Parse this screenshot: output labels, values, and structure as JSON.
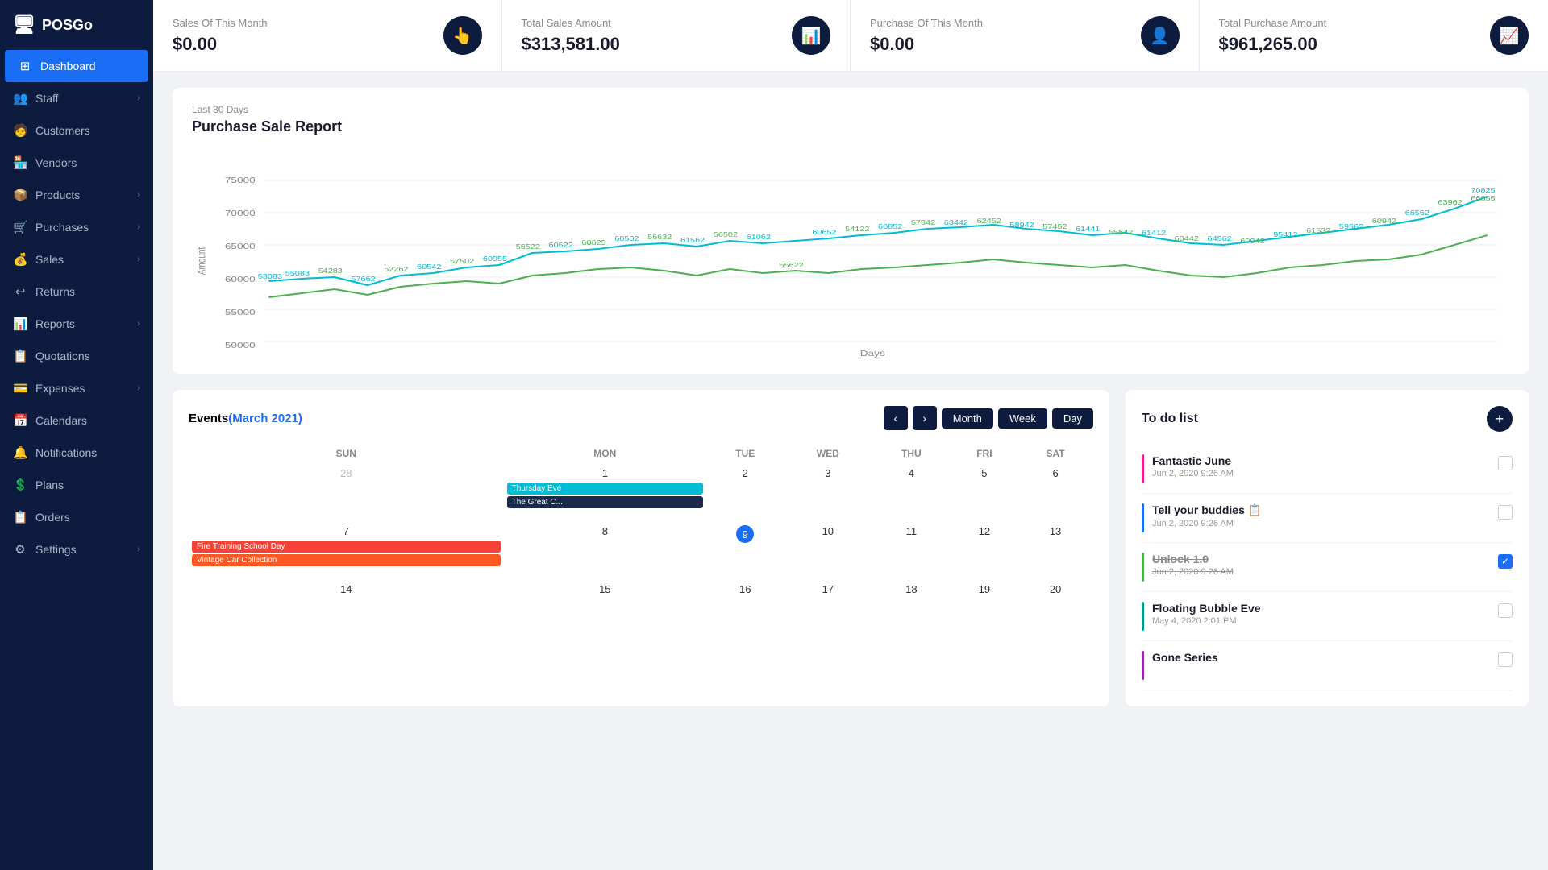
{
  "app": {
    "name": "POSGo",
    "logo_icon": "🖥"
  },
  "sidebar": {
    "items": [
      {
        "id": "dashboard",
        "label": "Dashboard",
        "icon": "⊞",
        "active": true,
        "has_arrow": false
      },
      {
        "id": "staff",
        "label": "Staff",
        "icon": "👥",
        "active": false,
        "has_arrow": true
      },
      {
        "id": "customers",
        "label": "Customers",
        "icon": "🧑",
        "active": false,
        "has_arrow": false
      },
      {
        "id": "vendors",
        "label": "Vendors",
        "icon": "🏪",
        "active": false,
        "has_arrow": false
      },
      {
        "id": "products",
        "label": "Products",
        "icon": "📦",
        "active": false,
        "has_arrow": true
      },
      {
        "id": "purchases",
        "label": "Purchases",
        "icon": "🛒",
        "active": false,
        "has_arrow": true
      },
      {
        "id": "sales",
        "label": "Sales",
        "icon": "💰",
        "active": false,
        "has_arrow": true
      },
      {
        "id": "returns",
        "label": "Returns",
        "icon": "↩",
        "active": false,
        "has_arrow": false
      },
      {
        "id": "reports",
        "label": "Reports",
        "icon": "📊",
        "active": false,
        "has_arrow": true
      },
      {
        "id": "quotations",
        "label": "Quotations",
        "icon": "📋",
        "active": false,
        "has_arrow": false
      },
      {
        "id": "expenses",
        "label": "Expenses",
        "icon": "💳",
        "active": false,
        "has_arrow": true
      },
      {
        "id": "calendars",
        "label": "Calendars",
        "icon": "📅",
        "active": false,
        "has_arrow": false
      },
      {
        "id": "notifications",
        "label": "Notifications",
        "icon": "🔔",
        "active": false,
        "has_arrow": false
      },
      {
        "id": "plans",
        "label": "Plans",
        "icon": "💲",
        "active": false,
        "has_arrow": false
      },
      {
        "id": "orders",
        "label": "Orders",
        "icon": "📋",
        "active": false,
        "has_arrow": false
      },
      {
        "id": "settings",
        "label": "Settings",
        "icon": "⚙",
        "active": false,
        "has_arrow": true
      }
    ]
  },
  "top_cards": [
    {
      "label": "Sales Of This Month",
      "value": "$0.00",
      "icon": "👆"
    },
    {
      "label": "Total Sales Amount",
      "value": "$313,581.00",
      "icon": "📊"
    },
    {
      "label": "Purchase Of This Month",
      "value": "$0.00",
      "icon": "👤"
    },
    {
      "label": "Total Purchase Amount",
      "value": "$961,265.00",
      "icon": "📈"
    }
  ],
  "chart": {
    "subtitle": "Last 30 Days",
    "title": "Purchase Sale Report",
    "x_label": "Days",
    "y_label": "Amount",
    "y_ticks": [
      "50000",
      "55000",
      "60000",
      "65000",
      "70000",
      "75000"
    ]
  },
  "events": {
    "title": "Events",
    "month_label": "March 2021",
    "prev_btn": "‹",
    "next_btn": "›",
    "view_buttons": [
      "Month",
      "Week",
      "Day"
    ],
    "days_of_week": [
      "SUN",
      "MON",
      "TUE",
      "WED",
      "THU",
      "FRI",
      "SAT"
    ],
    "rows": [
      {
        "cells": [
          {
            "num": "28",
            "prev": true,
            "today": false,
            "events": []
          },
          {
            "num": "1",
            "prev": false,
            "today": false,
            "events": [
              {
                "label": "Thursday Eve",
                "color": "cyan"
              },
              {
                "label": "The Great C...",
                "color": "dark"
              }
            ]
          },
          {
            "num": "2",
            "prev": false,
            "today": false,
            "events": []
          },
          {
            "num": "3",
            "prev": false,
            "today": false,
            "events": []
          },
          {
            "num": "4",
            "prev": false,
            "today": false,
            "events": []
          },
          {
            "num": "5",
            "prev": false,
            "today": false,
            "events": []
          },
          {
            "num": "6",
            "prev": false,
            "today": false,
            "events": []
          }
        ]
      },
      {
        "cells": [
          {
            "num": "7",
            "prev": false,
            "today": false,
            "events": [
              {
                "label": "Fire Training School Day",
                "color": "red"
              },
              {
                "label": "Vintage Car Collection",
                "color": "orange"
              }
            ]
          },
          {
            "num": "8",
            "prev": false,
            "today": false,
            "events": []
          },
          {
            "num": "9",
            "prev": false,
            "today": true,
            "events": []
          },
          {
            "num": "10",
            "prev": false,
            "today": false,
            "events": []
          },
          {
            "num": "11",
            "prev": false,
            "today": false,
            "events": []
          },
          {
            "num": "12",
            "prev": false,
            "today": false,
            "events": []
          },
          {
            "num": "13",
            "prev": false,
            "today": false,
            "events": []
          }
        ]
      },
      {
        "cells": [
          {
            "num": "14",
            "prev": false,
            "today": false,
            "events": []
          },
          {
            "num": "15",
            "prev": false,
            "today": false,
            "events": []
          },
          {
            "num": "16",
            "prev": false,
            "today": false,
            "events": []
          },
          {
            "num": "17",
            "prev": false,
            "today": false,
            "events": []
          },
          {
            "num": "18",
            "prev": false,
            "today": false,
            "events": []
          },
          {
            "num": "19",
            "prev": false,
            "today": false,
            "events": []
          },
          {
            "num": "20",
            "prev": false,
            "today": false,
            "events": []
          }
        ]
      }
    ]
  },
  "todo": {
    "title": "To do list",
    "add_btn": "+",
    "items": [
      {
        "title": "Fantastic June",
        "date": "Jun 2, 2020 9:26 AM",
        "bar": "pink",
        "done": false
      },
      {
        "title": "Tell your buddies 📋",
        "date": "Jun 2, 2020 9:26 AM",
        "bar": "blue",
        "done": false
      },
      {
        "title": "Unlock 1.0",
        "date": "Jun 2, 2020 9:26 AM",
        "bar": "green",
        "done": true
      },
      {
        "title": "Floating Bubble Eve",
        "date": "May 4, 2020 2:01 PM",
        "bar": "teal",
        "done": false
      },
      {
        "title": "Gone Series",
        "date": "",
        "bar": "purple",
        "done": false
      }
    ]
  },
  "view_buttons": {
    "month": "Month",
    "week": "Week",
    "day": "Day"
  }
}
